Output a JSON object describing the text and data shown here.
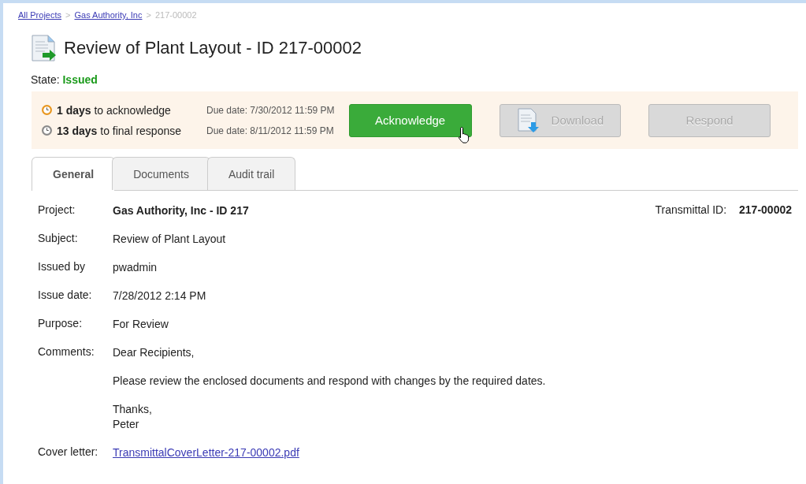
{
  "breadcrumb_separator": ">",
  "breadcrumbs": [
    {
      "label": "All Projects",
      "kind": "link"
    },
    {
      "label": "Gas Authority, Inc",
      "kind": "link"
    },
    {
      "label": "217-00002",
      "kind": "current"
    }
  ],
  "title": "Review of Plant Layout - ID 217-00002",
  "state": {
    "label": "State:",
    "value": "Issued"
  },
  "deadlines": [
    {
      "days": "1 days",
      "text": "to acknowledge",
      "due": "Due date: 7/30/2012 11:59 PM",
      "color": "#e8961e"
    },
    {
      "days": "13 days",
      "text": "to final response",
      "due": "Due date: 8/11/2012 11:59 PM",
      "color": "#8a8a8a"
    }
  ],
  "actions": [
    {
      "label": "Acknowledge",
      "kind": "primary",
      "disabled": false
    },
    {
      "label": "Download",
      "kind": "download",
      "disabled": true
    },
    {
      "label": "Respond",
      "kind": "plain",
      "disabled": true
    }
  ],
  "tabs": [
    {
      "label": "General",
      "selected": true
    },
    {
      "label": "Documents",
      "selected": false
    },
    {
      "label": "Audit trail",
      "selected": false
    }
  ],
  "fields": [
    {
      "label": "Project:",
      "kind": "bold",
      "lines": [
        "Gas Authority, Inc - ID 217"
      ]
    },
    {
      "label": "Subject:",
      "kind": "text",
      "lines": [
        "Review of Plant Layout"
      ]
    },
    {
      "label": "Issued by",
      "kind": "text",
      "lines": [
        "pwadmin"
      ]
    },
    {
      "label": "Issue date:",
      "kind": "text",
      "lines": [
        "7/28/2012 2:14 PM"
      ]
    },
    {
      "label": "Purpose:",
      "kind": "text",
      "lines": [
        "For Review"
      ]
    },
    {
      "label": "Comments:",
      "kind": "text",
      "lines": [
        "Dear Recipients,",
        "Please review the enclosed documents and respond with changes by the required dates.",
        "Thanks,\nPeter"
      ]
    },
    {
      "label": "Cover letter:",
      "kind": "link",
      "lines": [
        "TransmittalCoverLetter-217-00002.pdf"
      ]
    }
  ],
  "transmittal": {
    "label": "Transmittal ID:",
    "value": "217-00002"
  }
}
